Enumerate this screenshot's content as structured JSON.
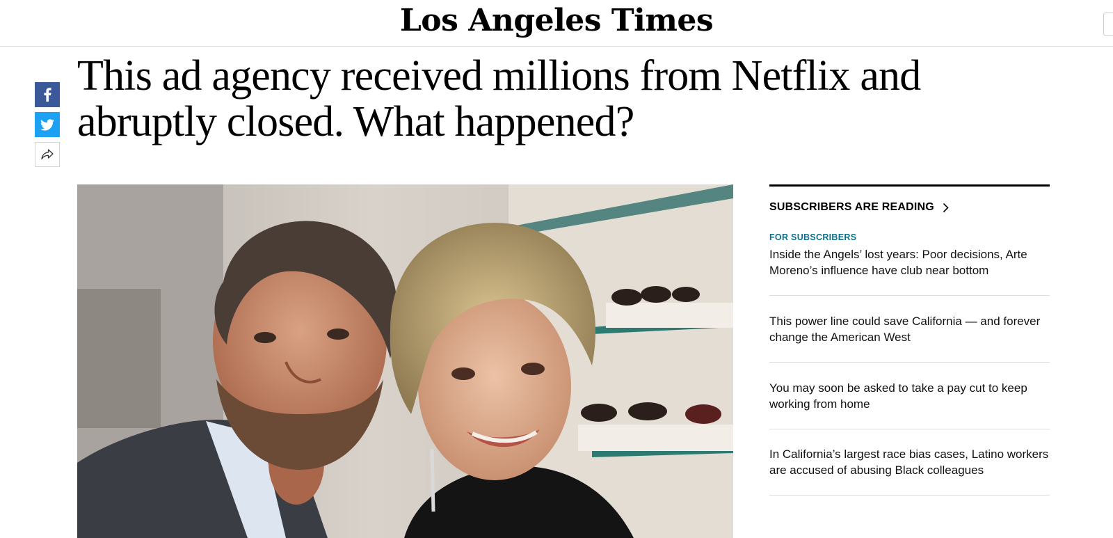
{
  "masthead": {
    "logo": "Los Angeles Times"
  },
  "share": {
    "facebook_icon": "facebook-icon",
    "twitter_icon": "twitter-icon",
    "share_icon": "share-arrow-icon"
  },
  "article": {
    "headline": "This ad agency received millions from Netflix and abruptly closed. What happened?"
  },
  "sidebar": {
    "title": "SUBSCRIBERS ARE READING",
    "chevron_icon": "chevron-right-icon",
    "items": [
      {
        "kicker": "FOR SUBSCRIBERS",
        "title": "Inside the Angels’ lost years: Poor decisions, Arte Moreno’s influence have club near bottom"
      },
      {
        "title": "This power line could save California — and forever change the American West"
      },
      {
        "title": "You may soon be asked to take a pay cut to keep working from home"
      },
      {
        "title": "In California’s largest race bias cases, Latino workers are accused of abusing Black colleagues"
      }
    ]
  },
  "colors": {
    "facebook": "#3b5998",
    "twitter": "#1da1f2",
    "kicker": "#0e6f8a"
  }
}
